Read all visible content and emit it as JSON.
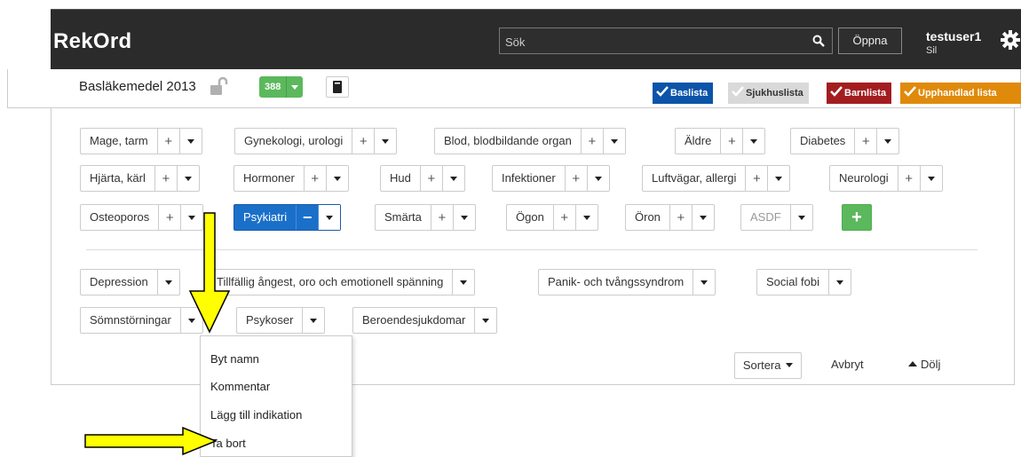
{
  "app": {
    "brand": "RekOrd"
  },
  "search": {
    "placeholder": "Sök",
    "open_label": "Öppna"
  },
  "user": {
    "name": "testuser1",
    "subtitle": "Sil"
  },
  "listbar": {
    "title": "Basläkemedel 2013",
    "count": "388",
    "tabs": [
      {
        "label": "Baslista",
        "color": "#0b54a9"
      },
      {
        "label": "Sjukhuslista",
        "color": "#d9d9d9"
      },
      {
        "label": "Barnlista",
        "color": "#a31d20"
      },
      {
        "label": "Upphandlad lista",
        "color": "#e08a0b"
      }
    ]
  },
  "categories": [
    {
      "label": "Mage, tarm"
    },
    {
      "label": "Gynekologi, urologi"
    },
    {
      "label": "Blod, blodbildande organ"
    },
    {
      "label": "Äldre"
    },
    {
      "label": "Diabetes"
    },
    {
      "label": "Hjärta, kärl"
    },
    {
      "label": "Hormoner"
    },
    {
      "label": "Hud"
    },
    {
      "label": "Infektioner"
    },
    {
      "label": "Luftvägar, allergi"
    },
    {
      "label": "Neurologi"
    },
    {
      "label": "Osteoporos"
    },
    {
      "label": "Psykiatri",
      "active": true
    },
    {
      "label": "Smärta"
    },
    {
      "label": "Ögon"
    },
    {
      "label": "Öron"
    },
    {
      "label": "ASDF",
      "disabled": true
    }
  ],
  "subcategories": [
    {
      "label": "Depression"
    },
    {
      "label": "Tillfällig ångest, oro och emotionell spänning"
    },
    {
      "label": "Panik- och tvångssyndrom"
    },
    {
      "label": "Social fobi"
    },
    {
      "label": "Sömnstörningar"
    },
    {
      "label": "Psykoser"
    },
    {
      "label": "Beroendesjukdomar"
    }
  ],
  "footer": {
    "sort_label": "Sortera",
    "cancel_label": "Avbryt",
    "hide_label": "Dölj"
  },
  "menu": {
    "items": [
      "Byt namn",
      "Kommentar",
      "Lägg till indikation",
      "Ta bort"
    ]
  },
  "colors": {
    "accent_blue": "#1a6fc9",
    "add_green": "#5cb85c",
    "annotation_yellow": "#ffff00"
  }
}
